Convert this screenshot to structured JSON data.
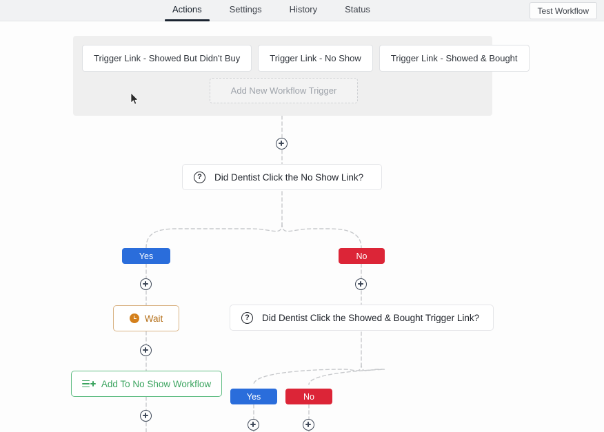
{
  "header": {
    "tabs": [
      {
        "label": "Actions",
        "active": true
      },
      {
        "label": "Settings",
        "active": false
      },
      {
        "label": "History",
        "active": false
      },
      {
        "label": "Status",
        "active": false
      }
    ],
    "test_workflow_label": "Test Workflow"
  },
  "triggers": {
    "chips": [
      {
        "label": "Trigger Link - Showed But Didn't Buy"
      },
      {
        "label": "Trigger Link - No Show"
      },
      {
        "label": "Trigger Link - Showed & Bought"
      }
    ],
    "add_label": "Add New Workflow Trigger"
  },
  "nodes": {
    "condition_1": {
      "label": "Did Dentist Click the No Show Link?",
      "icon": "question-icon"
    },
    "condition_2": {
      "label": "Did Dentist Click the Showed & Bought Trigger Link?",
      "icon": "question-icon"
    },
    "wait": {
      "label": "Wait",
      "icon": "clock-icon"
    },
    "add_workflow": {
      "label": "Add To No Show Workflow",
      "icon": "list-plus-icon"
    }
  },
  "branches": {
    "yes_label": "Yes",
    "no_label": "No"
  },
  "colors": {
    "yes": "#2a6ddb",
    "no": "#dc2537",
    "wait": "#b5701a",
    "workflow": "#3ba45f",
    "tab_active_underline": "#1b2430",
    "connector": "#c7c9cc"
  }
}
